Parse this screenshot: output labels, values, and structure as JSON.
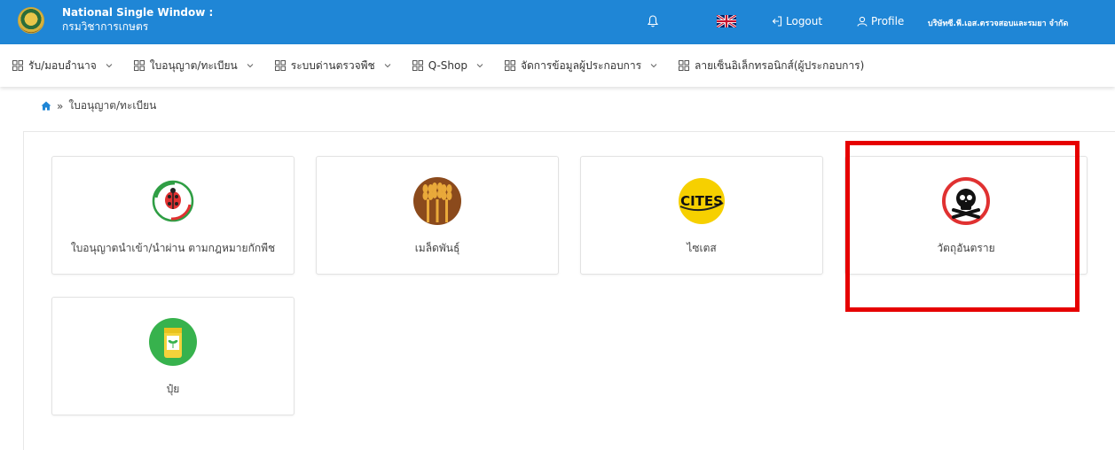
{
  "header": {
    "brand_title": "National Single Window :",
    "brand_subtitle": "กรมวิชาการเกษตร",
    "logout_label": "Logout",
    "profile_label": "Profile",
    "company_name": "บริษัทซี.พี.เอส.ตรวจสอบและรมยา จำกัด",
    "bg_color": "#1f86d6"
  },
  "menu": {
    "items": [
      {
        "label": "รับ/มอบอำนาจ"
      },
      {
        "label": "ใบอนุญาต/ทะเบียน"
      },
      {
        "label": "ระบบด่านตรวจพืช"
      },
      {
        "label": "Q-Shop"
      },
      {
        "label": "จัดการข้อมูลผู้ประกอบการ"
      },
      {
        "label": "ลายเซ็นอิเล็กทรอนิกส์(ผู้ประกอบการ)"
      }
    ]
  },
  "breadcrumb": {
    "separator": "»",
    "current": "ใบอนุญาต/ทะเบียน"
  },
  "cards": [
    {
      "label": "ใบอนุญาตนำเข้า/นำผ่าน ตามกฎหมายกักพืช",
      "icon": "plant-quarantine-icon"
    },
    {
      "label": "เมล็ดพันธุ์",
      "icon": "wheat-seed-icon"
    },
    {
      "label": "ไซเตส",
      "icon": "cites-icon"
    },
    {
      "label": "วัตถุอันตราย",
      "icon": "skull-hazard-icon"
    },
    {
      "label": "ปุ๋ย",
      "icon": "fertilizer-icon"
    }
  ],
  "highlight_color": "#e60000"
}
